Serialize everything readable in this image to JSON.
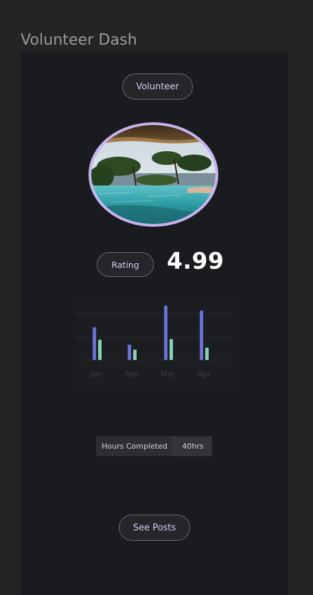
{
  "page": {
    "title": "Volunteer Dash"
  },
  "profile": {
    "role_label": "Volunteer",
    "photo_alt": "infinity-pool-photo"
  },
  "rating": {
    "label": "Rating",
    "value": "4.99"
  },
  "chart_data": {
    "type": "bar",
    "categories": [
      "Jan",
      "Feb",
      "Mar",
      "Apr"
    ],
    "series": [
      {
        "color": "#6a6fd6",
        "values": [
          53,
          25,
          88,
          80
        ]
      },
      {
        "color": "#86d1b2",
        "values": [
          33,
          17,
          34,
          20
        ]
      }
    ],
    "ylim": [
      0,
      100
    ],
    "grid": true,
    "legend": "none"
  },
  "stats": {
    "hours_label": "Hours Completed",
    "hours_value": "40hrs"
  },
  "actions": {
    "see_posts_label": "See Posts"
  },
  "colors": {
    "accent": "#c7b3f0",
    "background": "#242424",
    "panel": "#1a1b1e"
  }
}
